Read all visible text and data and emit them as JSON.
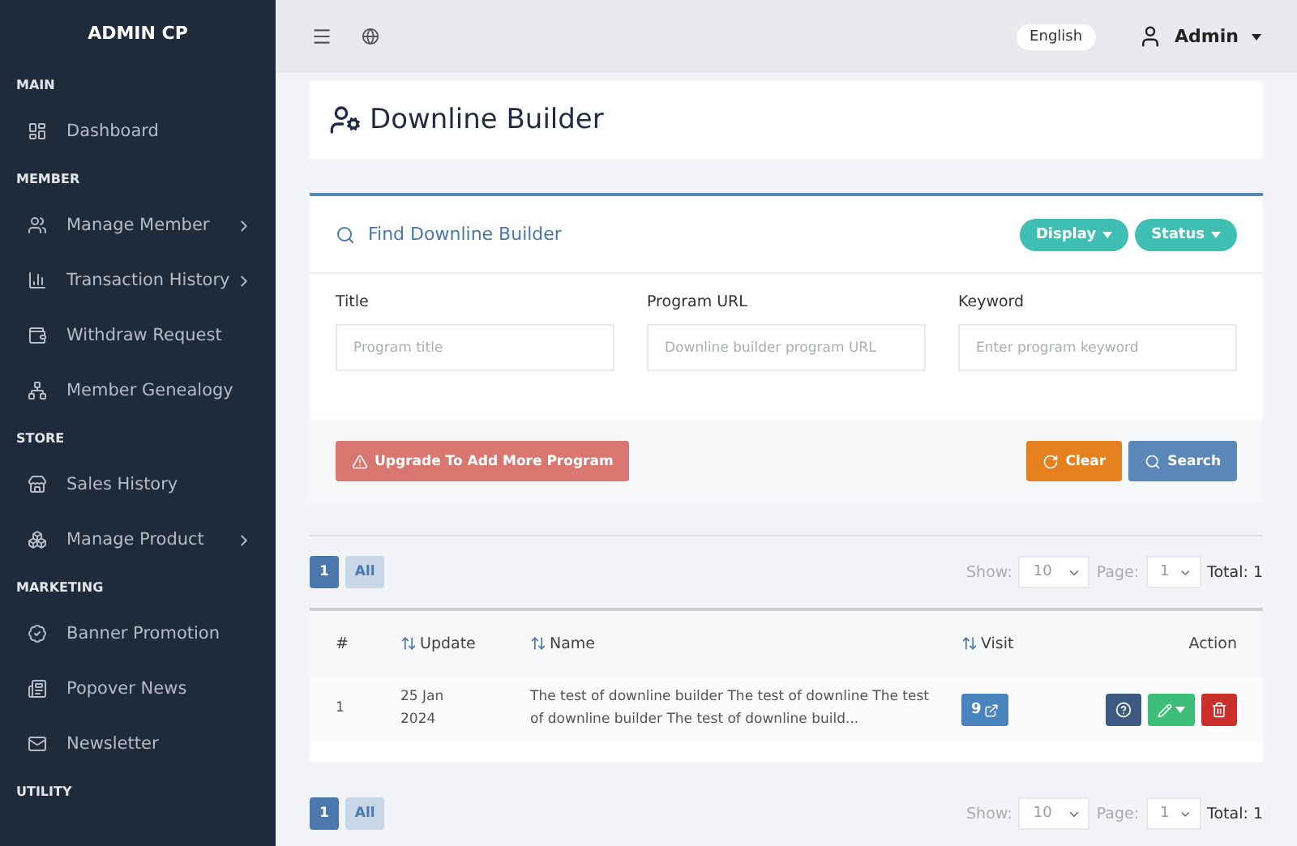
{
  "sidebar": {
    "title": "ADMIN CP",
    "sections": [
      {
        "label": "MAIN",
        "items": [
          {
            "label": "Dashboard",
            "expandable": false
          }
        ]
      },
      {
        "label": "MEMBER",
        "items": [
          {
            "label": "Manage Member",
            "expandable": true
          },
          {
            "label": "Transaction History",
            "expandable": true
          },
          {
            "label": "Withdraw Request",
            "expandable": false
          },
          {
            "label": "Member Genealogy",
            "expandable": false
          }
        ]
      },
      {
        "label": "STORE",
        "items": [
          {
            "label": "Sales History",
            "expandable": false
          },
          {
            "label": "Manage Product",
            "expandable": true
          }
        ]
      },
      {
        "label": "MARKETING",
        "items": [
          {
            "label": "Banner Promotion",
            "expandable": false
          },
          {
            "label": "Popover News",
            "expandable": false
          },
          {
            "label": "Newsletter",
            "expandable": false
          }
        ]
      },
      {
        "label": "UTILITY"
      }
    ]
  },
  "topbar": {
    "language": "English",
    "user": "Admin"
  },
  "page_title": "Downline Builder",
  "search_panel": {
    "title": "Find Downline Builder",
    "filters": [
      "Display",
      "Status"
    ],
    "fields": [
      {
        "label": "Title",
        "placeholder": "Program title"
      },
      {
        "label": "Program URL",
        "placeholder": "Downline builder program URL"
      },
      {
        "label": "Keyword",
        "placeholder": "Enter program keyword"
      }
    ],
    "upgrade_button": "Upgrade To Add More Program",
    "clear_button": "Clear",
    "search_button": "Search"
  },
  "pagination": {
    "pages": [
      {
        "label": "1",
        "selected": true
      },
      {
        "label": "All",
        "selected": false
      }
    ],
    "show_label": "Show:",
    "show_value": "10",
    "page_label": "Page:",
    "page_value": "1",
    "total": "Total: 1"
  },
  "table": {
    "columns": [
      {
        "label": "#",
        "sortable": false
      },
      {
        "label": "Update",
        "sortable": true
      },
      {
        "label": "Name",
        "sortable": true
      },
      {
        "label": "Visit",
        "sortable": true
      },
      {
        "label": "Action",
        "sortable": false
      }
    ],
    "rows": [
      {
        "number": "1",
        "update": "25 Jan 2024",
        "name": "The test of downline builder The test of downline The test of downline builder The test of downline build...",
        "visit": "9"
      }
    ]
  },
  "pagination_bottom": {
    "pages": [
      {
        "label": "1",
        "selected": true
      },
      {
        "label": "All",
        "selected": false
      }
    ],
    "show_label": "Show:",
    "show_value": "10",
    "page_label": "Page:",
    "page_value": "1",
    "total": "Total: 1"
  }
}
